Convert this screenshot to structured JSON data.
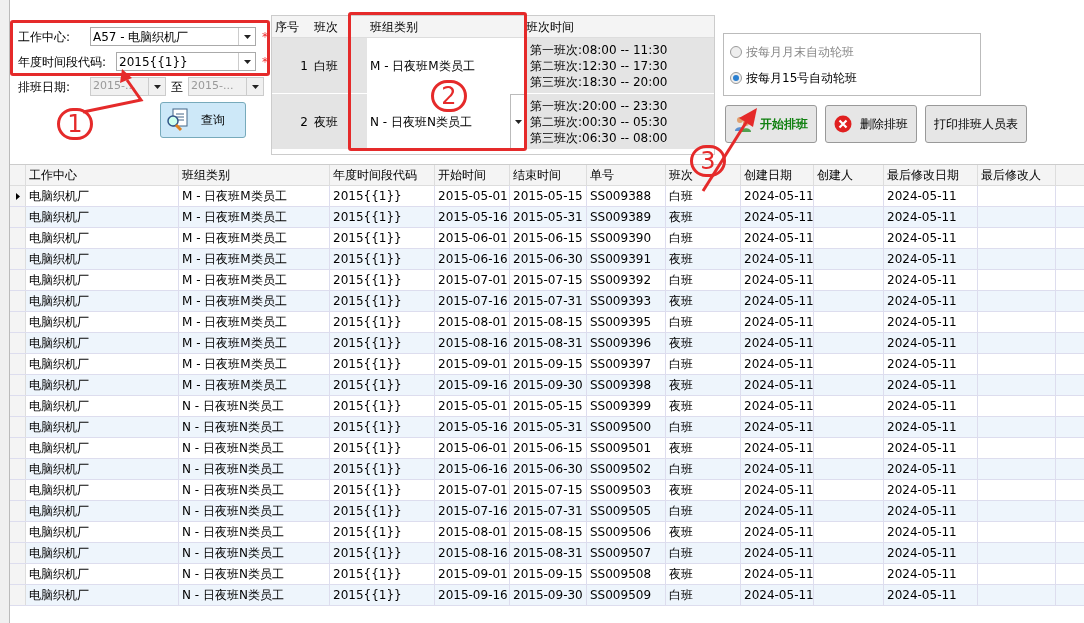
{
  "form": {
    "work_center": {
      "label": "工作中心:",
      "value": "A57 - 电脑织机厂",
      "required": "*"
    },
    "period_code": {
      "label": "年度时间段代码:",
      "value": "2015{{1}}",
      "required": "*"
    },
    "date_range": {
      "label": "排班日期:",
      "from": "2015-...",
      "separator": "至",
      "to": "2015-...",
      "disabled": true
    },
    "query_button": "查询"
  },
  "shift_table": {
    "columns": [
      "序号",
      "班次",
      "班组类别",
      "班次时间"
    ],
    "rows": [
      {
        "index": "1",
        "shift": "白班",
        "group": "M - 日夜班M类员工",
        "times": [
          "第一班次:08:00 -- 11:30",
          "第二班次:12:30 -- 17:30",
          "第三班次:18:30 -- 20:00"
        ],
        "editing": false
      },
      {
        "index": "2",
        "shift": "夜班",
        "group": "N - 日夜班N类员工",
        "times": [
          "第一班次:20:00 -- 23:30",
          "第二班次:00:30 -- 05:30",
          "第三班次:06:30 -- 08:00"
        ],
        "editing": true
      }
    ]
  },
  "rotation_options": [
    {
      "label": "按每月月末自动轮班",
      "selected": false,
      "disabled": true
    },
    {
      "label": "按每月15号自动轮班",
      "selected": true,
      "disabled": false
    }
  ],
  "actions": [
    {
      "kind": "start",
      "label": "开始排班"
    },
    {
      "kind": "delete",
      "label": "删除排班"
    },
    {
      "kind": "print",
      "label": "打印排班人员表"
    }
  ],
  "grid": {
    "columns": [
      "工作中心",
      "班组类别",
      "年度时间段代码",
      "开始时间",
      "结束时间",
      "单号",
      "班次",
      "创建日期",
      "创建人",
      "最后修改日期",
      "最后修改人"
    ],
    "rows": [
      {
        "current": true,
        "cells": [
          "电脑织机厂",
          "M - 日夜班M类员工",
          "2015{{1}}",
          "2015-05-01",
          "2015-05-15",
          "SS009388",
          "白班",
          "2024-05-11",
          "",
          "2024-05-11",
          ""
        ]
      },
      {
        "current": false,
        "cells": [
          "电脑织机厂",
          "M - 日夜班M类员工",
          "2015{{1}}",
          "2015-05-16",
          "2015-05-31",
          "SS009389",
          "夜班",
          "2024-05-11",
          "",
          "2024-05-11",
          ""
        ]
      },
      {
        "current": false,
        "cells": [
          "电脑织机厂",
          "M - 日夜班M类员工",
          "2015{{1}}",
          "2015-06-01",
          "2015-06-15",
          "SS009390",
          "白班",
          "2024-05-11",
          "",
          "2024-05-11",
          ""
        ]
      },
      {
        "current": false,
        "cells": [
          "电脑织机厂",
          "M - 日夜班M类员工",
          "2015{{1}}",
          "2015-06-16",
          "2015-06-30",
          "SS009391",
          "夜班",
          "2024-05-11",
          "",
          "2024-05-11",
          ""
        ]
      },
      {
        "current": false,
        "cells": [
          "电脑织机厂",
          "M - 日夜班M类员工",
          "2015{{1}}",
          "2015-07-01",
          "2015-07-15",
          "SS009392",
          "白班",
          "2024-05-11",
          "",
          "2024-05-11",
          ""
        ]
      },
      {
        "current": false,
        "cells": [
          "电脑织机厂",
          "M - 日夜班M类员工",
          "2015{{1}}",
          "2015-07-16",
          "2015-07-31",
          "SS009393",
          "夜班",
          "2024-05-11",
          "",
          "2024-05-11",
          ""
        ]
      },
      {
        "current": false,
        "cells": [
          "电脑织机厂",
          "M - 日夜班M类员工",
          "2015{{1}}",
          "2015-08-01",
          "2015-08-15",
          "SS009395",
          "白班",
          "2024-05-11",
          "",
          "2024-05-11",
          ""
        ]
      },
      {
        "current": false,
        "cells": [
          "电脑织机厂",
          "M - 日夜班M类员工",
          "2015{{1}}",
          "2015-08-16",
          "2015-08-31",
          "SS009396",
          "夜班",
          "2024-05-11",
          "",
          "2024-05-11",
          ""
        ]
      },
      {
        "current": false,
        "cells": [
          "电脑织机厂",
          "M - 日夜班M类员工",
          "2015{{1}}",
          "2015-09-01",
          "2015-09-15",
          "SS009397",
          "白班",
          "2024-05-11",
          "",
          "2024-05-11",
          ""
        ]
      },
      {
        "current": false,
        "cells": [
          "电脑织机厂",
          "M - 日夜班M类员工",
          "2015{{1}}",
          "2015-09-16",
          "2015-09-30",
          "SS009398",
          "夜班",
          "2024-05-11",
          "",
          "2024-05-11",
          ""
        ]
      },
      {
        "current": false,
        "cells": [
          "电脑织机厂",
          "N - 日夜班N类员工",
          "2015{{1}}",
          "2015-05-01",
          "2015-05-15",
          "SS009399",
          "夜班",
          "2024-05-11",
          "",
          "2024-05-11",
          ""
        ]
      },
      {
        "current": false,
        "cells": [
          "电脑织机厂",
          "N - 日夜班N类员工",
          "2015{{1}}",
          "2015-05-16",
          "2015-05-31",
          "SS009500",
          "白班",
          "2024-05-11",
          "",
          "2024-05-11",
          ""
        ]
      },
      {
        "current": false,
        "cells": [
          "电脑织机厂",
          "N - 日夜班N类员工",
          "2015{{1}}",
          "2015-06-01",
          "2015-06-15",
          "SS009501",
          "夜班",
          "2024-05-11",
          "",
          "2024-05-11",
          ""
        ]
      },
      {
        "current": false,
        "cells": [
          "电脑织机厂",
          "N - 日夜班N类员工",
          "2015{{1}}",
          "2015-06-16",
          "2015-06-30",
          "SS009502",
          "白班",
          "2024-05-11",
          "",
          "2024-05-11",
          ""
        ]
      },
      {
        "current": false,
        "cells": [
          "电脑织机厂",
          "N - 日夜班N类员工",
          "2015{{1}}",
          "2015-07-01",
          "2015-07-15",
          "SS009503",
          "夜班",
          "2024-05-11",
          "",
          "2024-05-11",
          ""
        ]
      },
      {
        "current": false,
        "cells": [
          "电脑织机厂",
          "N - 日夜班N类员工",
          "2015{{1}}",
          "2015-07-16",
          "2015-07-31",
          "SS009505",
          "白班",
          "2024-05-11",
          "",
          "2024-05-11",
          ""
        ]
      },
      {
        "current": false,
        "cells": [
          "电脑织机厂",
          "N - 日夜班N类员工",
          "2015{{1}}",
          "2015-08-01",
          "2015-08-15",
          "SS009506",
          "夜班",
          "2024-05-11",
          "",
          "2024-05-11",
          ""
        ]
      },
      {
        "current": false,
        "cells": [
          "电脑织机厂",
          "N - 日夜班N类员工",
          "2015{{1}}",
          "2015-08-16",
          "2015-08-31",
          "SS009507",
          "白班",
          "2024-05-11",
          "",
          "2024-05-11",
          ""
        ]
      },
      {
        "current": false,
        "cells": [
          "电脑织机厂",
          "N - 日夜班N类员工",
          "2015{{1}}",
          "2015-09-01",
          "2015-09-15",
          "SS009508",
          "夜班",
          "2024-05-11",
          "",
          "2024-05-11",
          ""
        ]
      },
      {
        "current": false,
        "cells": [
          "电脑织机厂",
          "N - 日夜班N类员工",
          "2015{{1}}",
          "2015-09-16",
          "2015-09-30",
          "SS009509",
          "白班",
          "2024-05-11",
          "",
          "2024-05-11",
          ""
        ]
      }
    ]
  },
  "annotations": [
    "1",
    "2",
    "3"
  ]
}
